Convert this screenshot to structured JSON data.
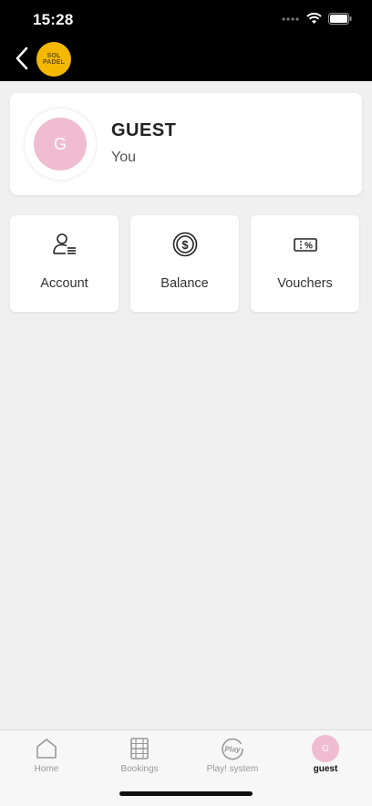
{
  "status_bar": {
    "time": "15:28"
  },
  "header": {
    "logo_text_line1": "SOL",
    "logo_text_line2": "PADEL",
    "logo_color": "#f5b800"
  },
  "profile": {
    "avatar_initial": "G",
    "name": "GUEST",
    "subtitle": "You",
    "avatar_color": "#efbcd0"
  },
  "tiles": [
    {
      "label": "Account",
      "icon": "account-icon"
    },
    {
      "label": "Balance",
      "icon": "balance-icon"
    },
    {
      "label": "Vouchers",
      "icon": "voucher-icon"
    }
  ],
  "tabbar": {
    "items": [
      {
        "label": "Home",
        "icon": "home-icon"
      },
      {
        "label": "Bookings",
        "icon": "bookings-icon"
      },
      {
        "label": "Play! system",
        "icon": "play-system-icon"
      },
      {
        "label": "guest",
        "icon": "avatar",
        "initial": "G",
        "active": true
      }
    ]
  }
}
